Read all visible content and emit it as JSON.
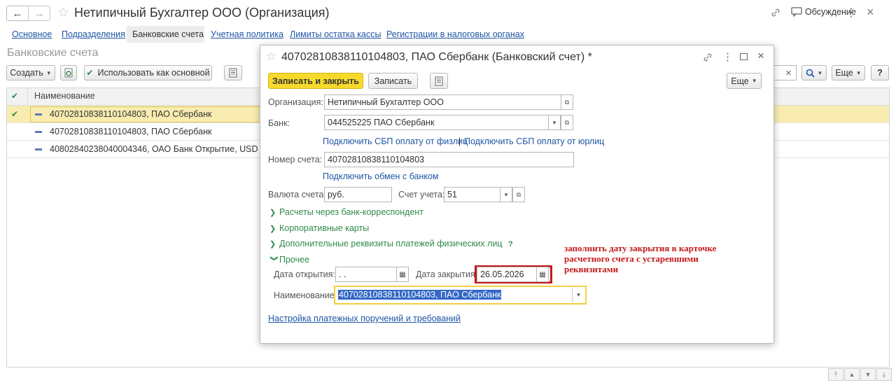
{
  "window": {
    "title": "Нетипичный Бухгалтер ООО (Организация)",
    "discussion": "Обсуждение"
  },
  "tabs": [
    "Основное",
    "Подразделения",
    "Банковские счета",
    "Учетная политика",
    "Лимиты остатка кассы",
    "Регистрации в налоговых органах"
  ],
  "list": {
    "title": "Банковские счета",
    "create_label": "Создать",
    "use_main_label": "Использовать как основной",
    "more_label": "Еще",
    "column_name": "Наименование",
    "rows": [
      "40702810838110104803, ПАО Сбербанк",
      "40702810838110104803, ПАО Сбербанк",
      "40802840238040004346, ОАО Банк Открытие, USD"
    ]
  },
  "dialog": {
    "title": "40702810838110104803, ПАО Сбербанк (Банковский счет) *",
    "save_close": "Записать и закрыть",
    "save": "Записать",
    "more": "Еще",
    "org_label": "Организация:",
    "org_value": "Нетипичный Бухгалтер ООО",
    "bank_label": "Банк:",
    "bank_value": "044525225 ПАО Сбербанк",
    "sbp_individual": "Подключить СБП оплату от физлиц",
    "sbp_separator": "|",
    "sbp_legal": "Подключить СБП оплату от юрлиц",
    "account_label": "Номер счета:",
    "account_value": "40702810838110104803",
    "bank_exchange": "Подключить обмен с банком",
    "currency_label": "Валюта счета:",
    "currency_value": "руб.",
    "ledger_label": "Счет учета:",
    "ledger_value": "51",
    "group_corr": "Расчеты через банк-корреспондент",
    "group_cards": "Корпоративные карты",
    "group_extra": "Дополнительные реквизиты платежей физических лиц",
    "help_mark": "?",
    "group_other": "Прочее",
    "open_date_label": "Дата открытия:",
    "open_date_value": " .  .",
    "close_date_label": "Дата закрытия:",
    "close_date_value": "26.05.2026",
    "name_label": "Наименование:",
    "name_value": "40702810838110104803, ПАО Сбербанк",
    "payment_settings": "Настройка платежных поручений и требований"
  },
  "annotation": "заполнить дату закрытия в карточке расчетного счета с устаревшими реквизитами",
  "colors": {
    "accent_yellow": "#f7d92c",
    "selected_row": "#f8ecb0",
    "link_blue": "#1e55a5",
    "green": "#2f8a4c",
    "annotation_red": "#c41a1a"
  }
}
